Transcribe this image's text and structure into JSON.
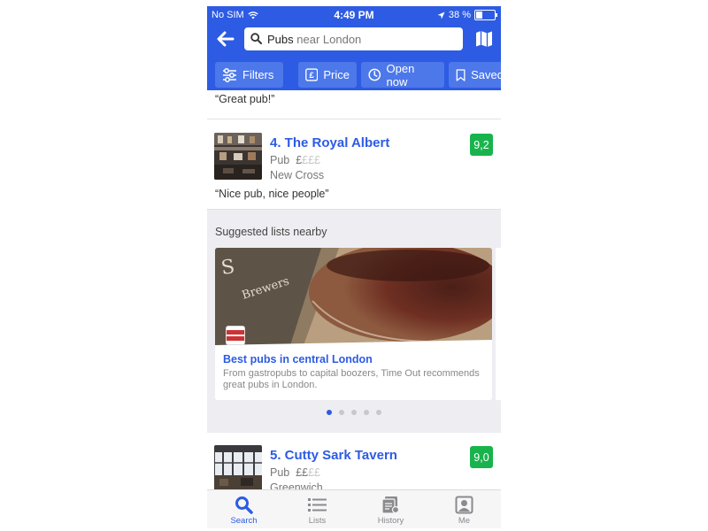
{
  "status_bar": {
    "carrier": "No SIM",
    "time": "4:49 PM",
    "battery": "38 %"
  },
  "search": {
    "term": "Pubs",
    "location_text": "near London"
  },
  "filters": [
    {
      "label": "Filters",
      "icon": "sliders-icon"
    },
    {
      "label": "Price",
      "icon": "pound-icon"
    },
    {
      "label": "Open now",
      "icon": "clock-icon"
    },
    {
      "label": "Saved",
      "icon": "bookmark-icon"
    }
  ],
  "results": [
    {
      "quote": "“Great pub!”"
    },
    {
      "name": "4. The Royal Albert",
      "type": "Pub",
      "price_active": "£",
      "price_inactive": "£££",
      "area": "New Cross",
      "score": "9,2",
      "quote": "“Nice pub, nice people”"
    },
    {
      "name": "5. Cutty Sark Tavern",
      "type": "Pub",
      "price_active": "££",
      "price_inactive": "££",
      "area": "Greenwich",
      "score": "9,0"
    }
  ],
  "suggested": {
    "heading": "Suggested lists nearby",
    "card": {
      "title": "Best pubs in central London",
      "description": "From gastropubs to capital boozers, Time Out recommends great pubs in London.",
      "badge": "TIME OUT London"
    },
    "page_count": 5,
    "active_page": 1
  },
  "tabs": [
    {
      "label": "Search",
      "icon": "search-icon",
      "active": true
    },
    {
      "label": "Lists",
      "icon": "list-icon",
      "active": false
    },
    {
      "label": "History",
      "icon": "history-icon",
      "active": false
    },
    {
      "label": "Me",
      "icon": "profile-icon",
      "active": false
    }
  ],
  "colors": {
    "brand_blue": "#2d5be3",
    "chip_blue": "#4d78ea",
    "score_green": "#19b34d"
  }
}
